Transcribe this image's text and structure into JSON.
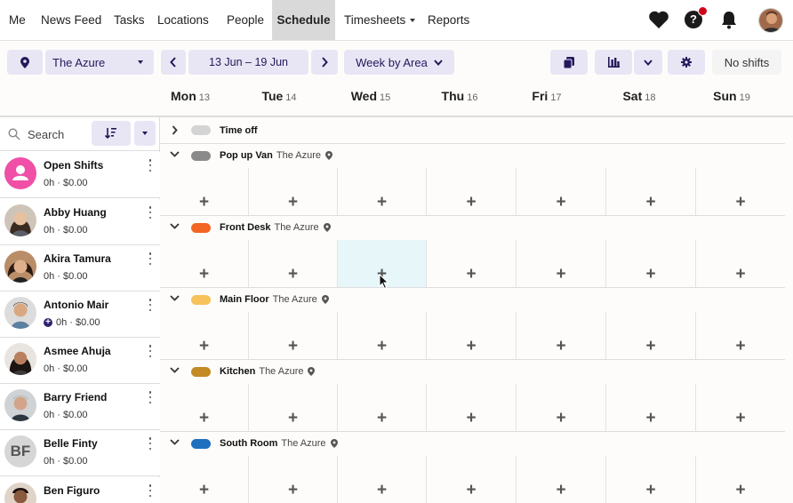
{
  "nav": {
    "items": [
      "Me",
      "News Feed",
      "Tasks",
      "Locations",
      "People",
      "Schedule",
      "Timesheets",
      "Reports"
    ],
    "active": "Schedule",
    "dropdown_item": "Timesheets"
  },
  "toolbar": {
    "location": "The Azure",
    "date_range": "13 Jun – 19 Jun",
    "view": "Week by Area",
    "no_shifts": "No shifts"
  },
  "days": [
    {
      "name": "Mon",
      "num": "13"
    },
    {
      "name": "Tue",
      "num": "14"
    },
    {
      "name": "Wed",
      "num": "15"
    },
    {
      "name": "Thu",
      "num": "16"
    },
    {
      "name": "Fri",
      "num": "17"
    },
    {
      "name": "Sat",
      "num": "18"
    },
    {
      "name": "Sun",
      "num": "19"
    }
  ],
  "sidebar": {
    "search_placeholder": "Search",
    "people": [
      {
        "name": "Open Shifts",
        "meta": "0h · $0.00",
        "avatar": "open"
      },
      {
        "name": "Abby Huang",
        "meta": "0h · $0.00",
        "avatar": "photo"
      },
      {
        "name": "Akira Tamura",
        "meta": "0h · $0.00",
        "avatar": "photo"
      },
      {
        "name": "Antonio Mair",
        "meta": "0h · $0.00",
        "avatar": "photo",
        "has_plus": true
      },
      {
        "name": "Asmee Ahuja",
        "meta": "0h · $0.00",
        "avatar": "photo"
      },
      {
        "name": "Barry Friend",
        "meta": "0h · $0.00",
        "avatar": "photo"
      },
      {
        "name": "Belle Finty",
        "meta": "0h · $0.00",
        "avatar": "initials",
        "initials": "BF"
      },
      {
        "name": "Ben Figuro",
        "meta": "",
        "avatar": "photo"
      }
    ]
  },
  "schedule": {
    "time_off_label": "Time off",
    "time_off_color": "#d4d4d4",
    "areas": [
      {
        "name": "Pop up Van",
        "location": "The Azure",
        "color": "#8a8a8a"
      },
      {
        "name": "Front Desk",
        "location": "The Azure",
        "color": "#f26522"
      },
      {
        "name": "Main Floor",
        "location": "The Azure",
        "color": "#f7c15b"
      },
      {
        "name": "Kitchen",
        "location": "The Azure",
        "color": "#c38a25"
      },
      {
        "name": "South Room",
        "location": "The Azure",
        "color": "#1f6fbf"
      }
    ],
    "add_symbol": "+"
  },
  "colors": {
    "accent_bg": "#e8e6f5",
    "accent_text": "#22195a",
    "open_shifts": "#ef4fa6",
    "highlight_cell": "#e7f7f9"
  }
}
